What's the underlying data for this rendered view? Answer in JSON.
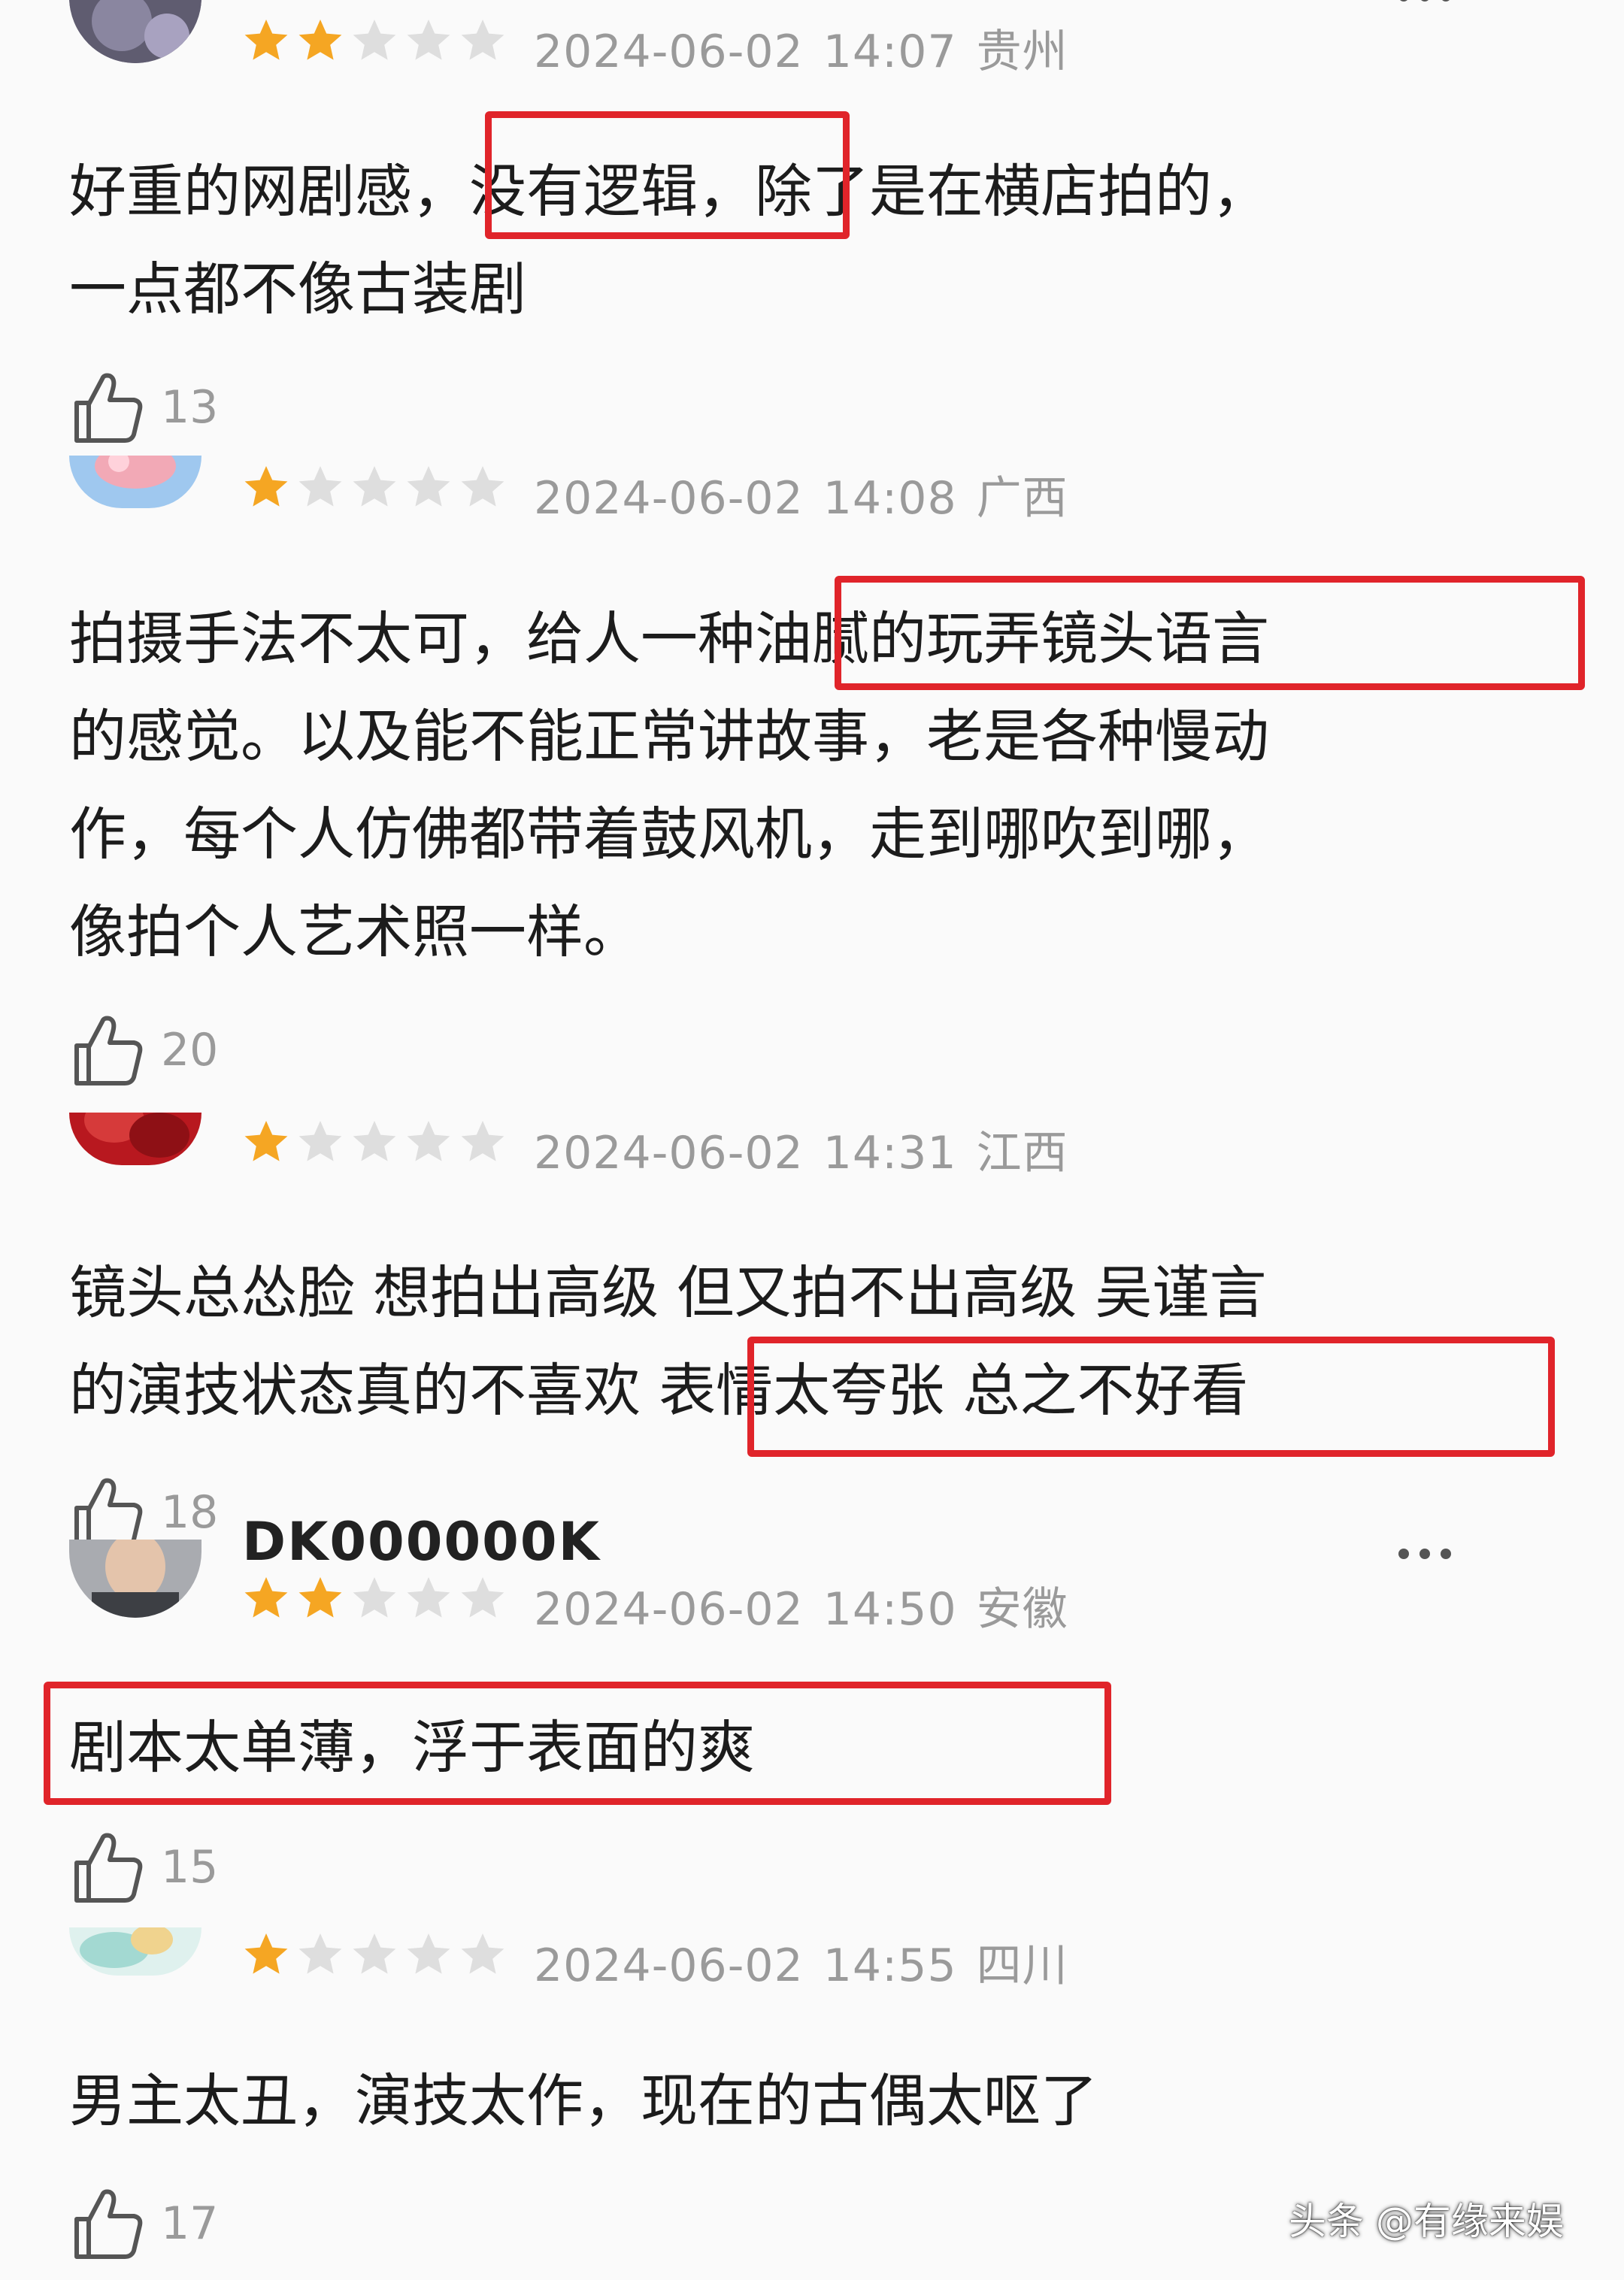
{
  "colors": {
    "star_active": "#f5a623",
    "star_inactive": "#dedede",
    "highlight_border": "#e0242a",
    "meta_text": "#9a9a9a"
  },
  "reviews": [
    {
      "username": "",
      "rating": 2,
      "date": "2024-06-02",
      "time": "14:07",
      "location": "贵州",
      "lines": [
        "好重的网剧感，没有逻辑，除了是在横店拍的，",
        "一点都不像古装剧"
      ],
      "likes": "13"
    },
    {
      "username": "",
      "rating": 1,
      "date": "2024-06-02",
      "time": "14:08",
      "location": "广西",
      "lines": [
        "拍摄手法不太可，给人一种油腻的玩弄镜头语言",
        "的感觉。以及能不能正常讲故事，老是各种慢动",
        "作，每个人仿佛都带着鼓风机，走到哪吹到哪，",
        "像拍个人艺术照一样。"
      ],
      "likes": "20"
    },
    {
      "username": "",
      "rating": 1,
      "date": "2024-06-02",
      "time": "14:31",
      "location": "江西",
      "lines": [
        "镜头总怂脸 想拍出高级 但又拍不出高级 吴谨言",
        "的演技状态真的不喜欢 表情太夸张 总之不好看"
      ],
      "likes": "18"
    },
    {
      "username": "DK000000K",
      "rating": 2,
      "date": "2024-06-02",
      "time": "14:50",
      "location": "安徽",
      "lines": [
        "剧本太单薄，浮于表面的爽"
      ],
      "likes": "15"
    },
    {
      "username": "",
      "rating": 1,
      "date": "2024-06-02",
      "time": "14:55",
      "location": "四川",
      "lines": [
        "男主太丑，演技太作，现在的古偶太呕了"
      ],
      "likes": "17"
    }
  ],
  "watermark": "头条 @有缘来娱"
}
